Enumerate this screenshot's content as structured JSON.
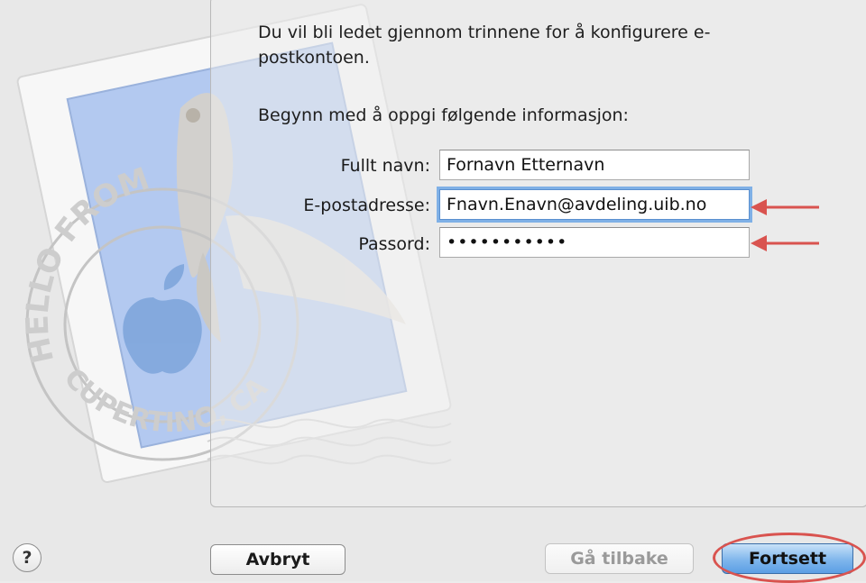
{
  "dialog": {
    "intro": "Du vil bli ledet gjennom trinnene for å konfigurere e-postkontoen.",
    "prompt": "Begynn med å oppgi følgende informasjon:"
  },
  "form": {
    "full_name": {
      "label": "Fullt navn:",
      "value": "Fornavn Etternavn"
    },
    "email": {
      "label": "E-postadresse:",
      "value": "Fnavn.Enavn@avdeling.uib.no"
    },
    "password": {
      "label": "Passord:",
      "value": "•••••••••••"
    }
  },
  "stamp": {
    "ring_text_top": "HELLO FROM",
    "ring_text_bottom": "CUPERTINO, CA"
  },
  "buttons": {
    "help": "?",
    "cancel": "Avbryt",
    "back": "Gå tilbake",
    "continue": "Fortsett"
  },
  "colors": {
    "annotation_red": "#d9534f",
    "accent_blue": "#5b9ee4",
    "focus_ring": "#7fb0e6"
  }
}
